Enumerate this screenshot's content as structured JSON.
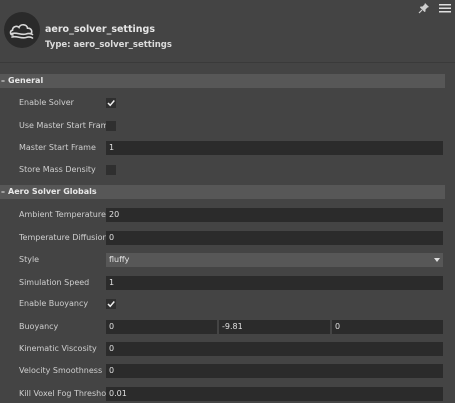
{
  "header": {
    "title": "aero_solver_settings",
    "subtitle": "Type: aero_solver_settings",
    "icon": "cloud-icon"
  },
  "toolbar": {
    "pin_icon": "pin-icon",
    "menu_icon": "hamburger-menu-icon"
  },
  "sections": {
    "general": {
      "collapse_glyph": "–",
      "label": "General"
    },
    "globals": {
      "collapse_glyph": "–",
      "label": "Aero Solver Globals"
    }
  },
  "general": {
    "enable_solver": {
      "label": "Enable Solver",
      "checked": true
    },
    "use_master_start_frame": {
      "label": "Use Master Start Frame",
      "checked": false
    },
    "master_start_frame": {
      "label": "Master Start Frame",
      "value": "1"
    },
    "store_mass_density": {
      "label": "Store Mass Density",
      "checked": false
    }
  },
  "globals": {
    "ambient_temperature": {
      "label": "Ambient Temperature",
      "value": "20"
    },
    "temperature_diffusion": {
      "label": "Temperature Diffusion",
      "value": "0"
    },
    "style": {
      "label": "Style",
      "value": "fluffy"
    },
    "simulation_speed": {
      "label": "Simulation Speed",
      "value": "1"
    },
    "enable_buoyancy": {
      "label": "Enable Buoyancy",
      "checked": true
    },
    "buoyancy": {
      "label": "Buoyancy",
      "x": "0",
      "y": "-9.81",
      "z": "0"
    },
    "kinematic_viscosity": {
      "label": "Kinematic Viscosity",
      "value": "0"
    },
    "velocity_smoothness": {
      "label": "Velocity Smoothness",
      "value": "0"
    },
    "kill_voxel_fog_threshold": {
      "label": "Kill Voxel Fog Threshold",
      "value": "0.01"
    }
  },
  "colors": {
    "background": "#444444",
    "section": "#575757",
    "field": "#2b2b2b"
  }
}
